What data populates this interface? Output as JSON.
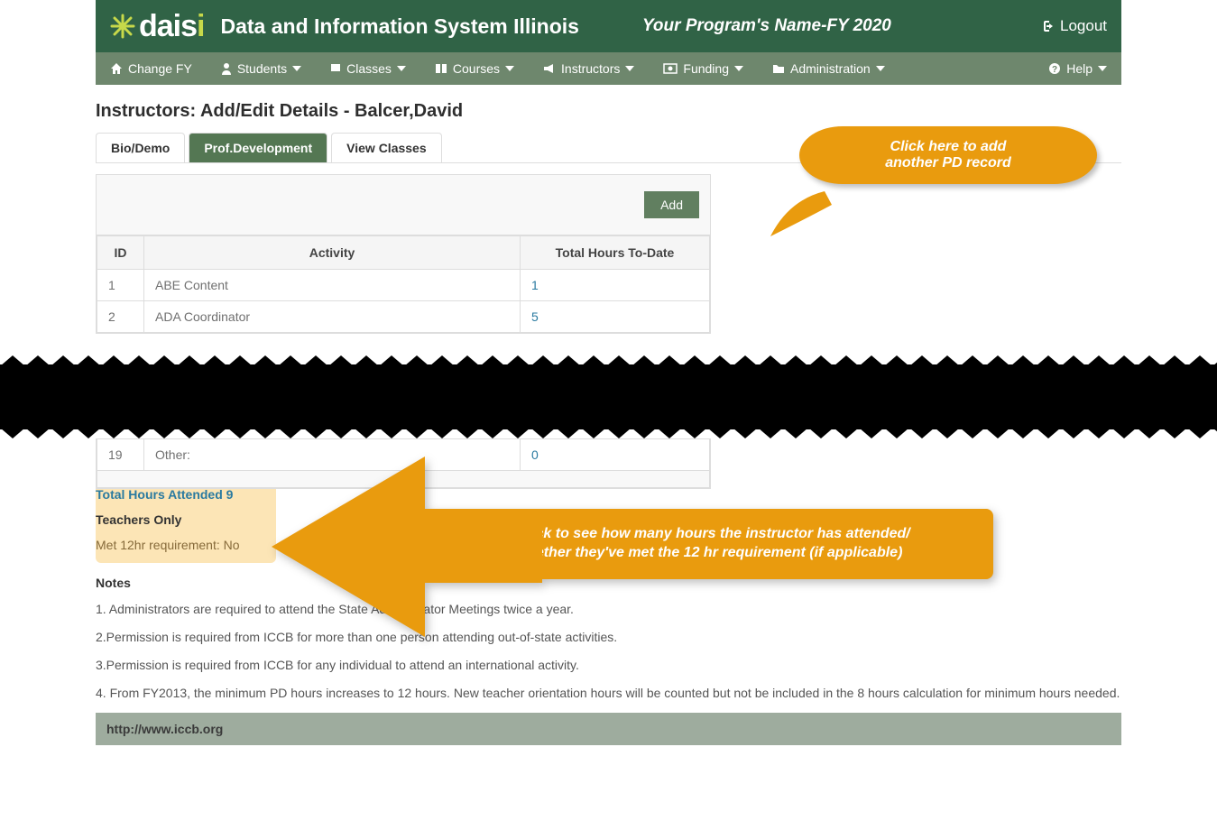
{
  "header": {
    "logo_text": "dais",
    "logo_accent": "i",
    "app_title": "Data and Information System Illinois",
    "program_name": "Your Program's Name-FY 2020",
    "logout": "Logout"
  },
  "nav": {
    "change_fy": "Change FY",
    "students": "Students",
    "classes": "Classes",
    "courses": "Courses",
    "instructors": "Instructors",
    "funding": "Funding",
    "administration": "Administration",
    "help": "Help"
  },
  "page_title": "Instructors: Add/Edit Details - Balcer,David",
  "tabs": {
    "bio": "Bio/Demo",
    "pd": "Prof.Development",
    "view": "View Classes"
  },
  "table": {
    "add_label": "Add",
    "col_id": "ID",
    "col_activity": "Activity",
    "col_hours": "Total Hours To-Date",
    "rows_top": [
      {
        "id": "1",
        "activity": "ABE Content",
        "hours": "1"
      },
      {
        "id": "2",
        "activity": "ADA Coordinator",
        "hours": "5"
      }
    ],
    "rows_bottom": [
      {
        "id": "19",
        "activity": "Other:",
        "hours": "0"
      }
    ]
  },
  "summary": {
    "total_hours": "Total Hours Attended 9",
    "teachers_only": "Teachers Only",
    "met_req": "Met 12hr requirement: No"
  },
  "notes_title": "Notes",
  "notes": [
    "1. Administrators are required to attend the State Administrator Meetings twice a year.",
    "2.Permission is required from ICCB for more than one person attending out-of-state activities.",
    "3.Permission is required from ICCB for any individual to attend an international activity.",
    "4. From FY2013, the minimum PD hours increases to 12 hours. New teacher orientation hours will be counted but not be included in the 8 hours calculation for minimum hours needed."
  ],
  "footer_url": "http://www.iccb.org",
  "callouts": {
    "c1_line1": "Click here to add",
    "c1_line2": "another PD record",
    "c2_line1": "Check to see how many hours the instructor has attended/",
    "c2_line2": "whether they've met the 12 hr requirement (if applicable)"
  }
}
